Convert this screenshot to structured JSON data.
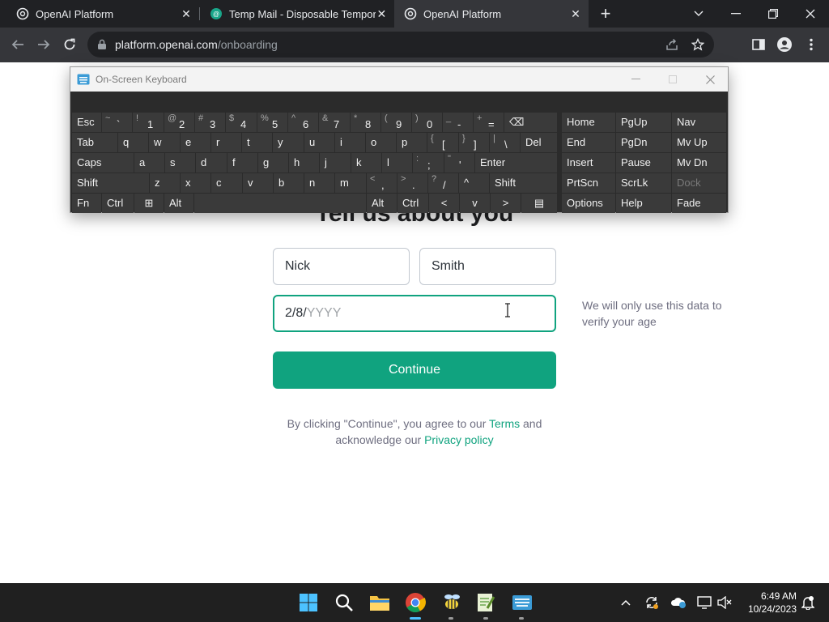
{
  "browser": {
    "tabs": [
      {
        "title": "OpenAI Platform",
        "active": false,
        "icon": "openai-icon"
      },
      {
        "title": "Temp Mail - Disposable Tempora",
        "active": false,
        "icon": "tempmail-icon"
      },
      {
        "title": "OpenAI Platform",
        "active": true,
        "icon": "openai-icon"
      }
    ],
    "tab_close_glyph": "✕",
    "new_tab_glyph": "+",
    "url_host": "platform.openai.com",
    "url_path": "/onboarding"
  },
  "page": {
    "heading": "Tell us about you",
    "first_name": "Nick",
    "last_name": "Smith",
    "birthday_typed": "2/8/",
    "birthday_placeholder_rest": "YYYY",
    "hint": "We will only use this data to verify your age",
    "continue_label": "Continue",
    "legal_pre": "By clicking \"Continue\", you agree to our ",
    "terms_link": "Terms",
    "legal_mid": " and acknowledge our ",
    "privacy_link": "Privacy policy",
    "accent_color": "#10a37f"
  },
  "osk": {
    "title": "On-Screen Keyboard",
    "rows": [
      [
        {
          "label": "Esc"
        },
        {
          "sh": "~",
          "mn": "`"
        },
        {
          "sh": "!",
          "mn": "1"
        },
        {
          "sh": "@",
          "mn": "2"
        },
        {
          "sh": "#",
          "mn": "3"
        },
        {
          "sh": "$",
          "mn": "4"
        },
        {
          "sh": "%",
          "mn": "5"
        },
        {
          "sh": "^",
          "mn": "6"
        },
        {
          "sh": "&",
          "mn": "7"
        },
        {
          "sh": "*",
          "mn": "8"
        },
        {
          "sh": "(",
          "mn": "9"
        },
        {
          "sh": ")",
          "mn": "0"
        },
        {
          "sh": "_",
          "mn": "-"
        },
        {
          "sh": "+",
          "mn": "="
        },
        {
          "label": "⌫"
        },
        {
          "label": "Home"
        },
        {
          "label": "PgUp"
        },
        {
          "label": "Nav"
        }
      ],
      [
        {
          "label": "Tab"
        },
        {
          "label": "q"
        },
        {
          "label": "w"
        },
        {
          "label": "e"
        },
        {
          "label": "r"
        },
        {
          "label": "t"
        },
        {
          "label": "y"
        },
        {
          "label": "u"
        },
        {
          "label": "i"
        },
        {
          "label": "o"
        },
        {
          "label": "p"
        },
        {
          "sh": "{",
          "mn": "["
        },
        {
          "sh": "}",
          "mn": "]"
        },
        {
          "sh": "|",
          "mn": "\\"
        },
        {
          "label": "Del"
        },
        {
          "label": "End"
        },
        {
          "label": "PgDn"
        },
        {
          "label": "Mv Up"
        }
      ],
      [
        {
          "label": "Caps"
        },
        {
          "label": "a"
        },
        {
          "label": "s"
        },
        {
          "label": "d"
        },
        {
          "label": "f"
        },
        {
          "label": "g"
        },
        {
          "label": "h"
        },
        {
          "label": "j"
        },
        {
          "label": "k"
        },
        {
          "label": "l"
        },
        {
          "sh": ":",
          "mn": ";"
        },
        {
          "sh": "\"",
          "mn": "'"
        },
        {
          "label": "Enter"
        },
        {
          "label": "Insert"
        },
        {
          "label": "Pause"
        },
        {
          "label": "Mv Dn"
        }
      ],
      [
        {
          "label": "Shift"
        },
        {
          "label": "z"
        },
        {
          "label": "x"
        },
        {
          "label": "c"
        },
        {
          "label": "v"
        },
        {
          "label": "b"
        },
        {
          "label": "n"
        },
        {
          "label": "m"
        },
        {
          "sh": "<",
          "mn": ","
        },
        {
          "sh": ">",
          "mn": "."
        },
        {
          "sh": "?",
          "mn": "/"
        },
        {
          "label": "^"
        },
        {
          "label": "Shift"
        },
        {
          "label": "PrtScn"
        },
        {
          "label": "ScrLk"
        },
        {
          "label": "Dock"
        }
      ],
      [
        {
          "label": "Fn"
        },
        {
          "label": "Ctrl"
        },
        {
          "label": "⊞"
        },
        {
          "label": "Alt"
        },
        {
          "label": ""
        },
        {
          "label": "Alt"
        },
        {
          "label": "Ctrl"
        },
        {
          "label": "<"
        },
        {
          "label": "v"
        },
        {
          "label": ">"
        },
        {
          "label": "▤"
        },
        {
          "label": "Options"
        },
        {
          "label": "Help"
        },
        {
          "label": "Fade"
        }
      ]
    ]
  },
  "taskbar": {
    "time": "6:49 AM",
    "date": "10/24/2023",
    "apps": [
      "start-icon",
      "search-icon",
      "file-explorer-icon",
      "chrome-icon",
      "bee-app-icon",
      "notepad-plus-icon",
      "onscreen-keyboard-icon"
    ]
  }
}
